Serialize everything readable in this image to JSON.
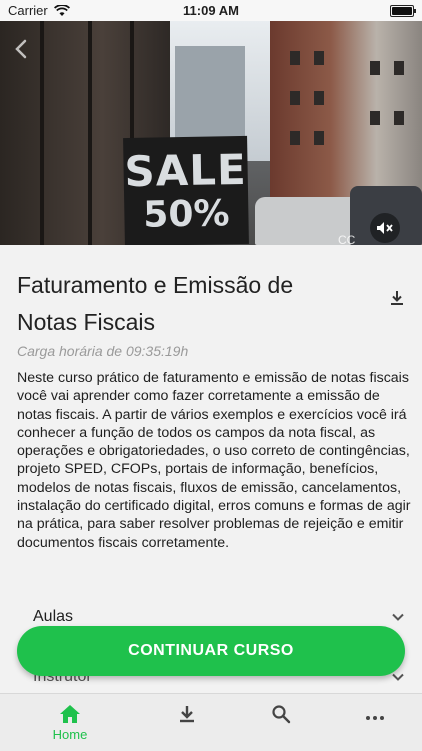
{
  "status_bar": {
    "carrier": "Carrier",
    "time": "11:09 AM",
    "battery_level": 1.0
  },
  "hero": {
    "sign_line1": "SALE",
    "sign_line2": "50%",
    "captions_label": "CC"
  },
  "course": {
    "title": "Faturamento e Emissão de Notas Fiscais",
    "hours": "Carga horária de 09:35:19h",
    "description": "Neste curso prático de faturamento e emissão de notas fiscais você vai aprender como fazer corretamente a emissão de notas fiscais. A partir de vários exemplos e exercícios você irá conhecer a função de todos os campos da nota fiscal, as operações e obrigatoriedades, o uso correto de contingências, projeto SPED, CFOPs, portais de informação, benefícios, modelos de notas fiscais, fluxos de emissão, cancelamentos, instalação do certificado digital, erros comuns e formas de agir na prática, para  saber resolver problemas de rejeição e emitir documentos fiscais corretamente."
  },
  "sections": {
    "aulas": "Aulas",
    "instrutor": "Instrutor"
  },
  "cta": {
    "label": "CONTINUAR CURSO"
  },
  "tabbar": {
    "home_label": "Home"
  },
  "colors": {
    "accent": "#1fc14c"
  }
}
